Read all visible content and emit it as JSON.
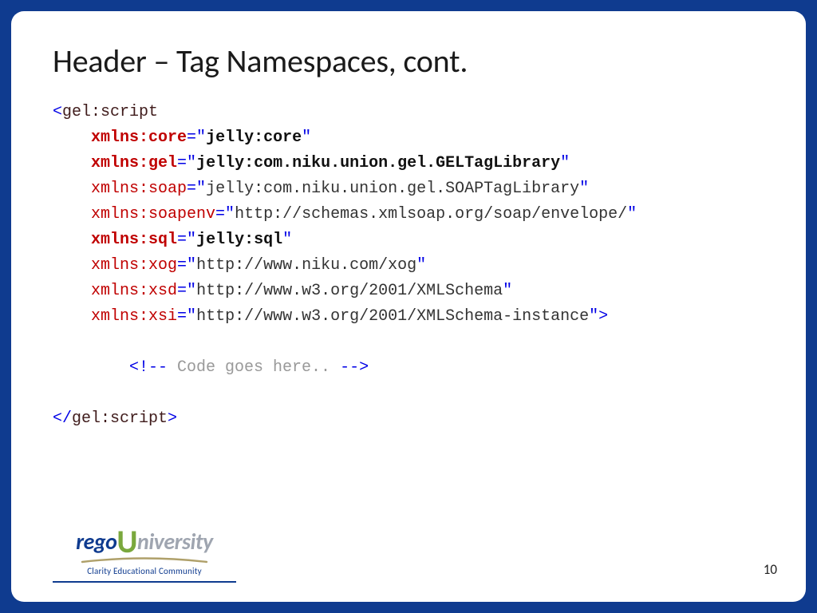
{
  "title": "Header – Tag Namespaces, cont.",
  "code": {
    "open_tag": "gel:script",
    "attrs": [
      {
        "name": "xmlns:core",
        "value": "jelly:core",
        "bold": true
      },
      {
        "name": "xmlns:gel",
        "value": "jelly:com.niku.union.gel.GELTagLibrary",
        "bold": true
      },
      {
        "name": "xmlns:soap",
        "value": "jelly:com.niku.union.gel.SOAPTagLibrary",
        "bold": false
      },
      {
        "name": "xmlns:soapenv",
        "value": "http://schemas.xmlsoap.org/soap/envelope/",
        "bold": false
      },
      {
        "name": "xmlns:sql",
        "value": "jelly:sql",
        "bold": true
      },
      {
        "name": "xmlns:xog",
        "value": "http://www.niku.com/xog",
        "bold": false
      },
      {
        "name": "xmlns:xsd",
        "value": "http://www.w3.org/2001/XMLSchema",
        "bold": false
      },
      {
        "name": "xmlns:xsi",
        "value": "http://www.w3.org/2001/XMLSchema-instance",
        "bold": false
      }
    ],
    "comment_open": "<!--",
    "comment_text": " Code goes here.. ",
    "comment_close": "-->",
    "close_tag": "gel:script"
  },
  "footer": {
    "logo_rego": "rego",
    "logo_u": "U",
    "logo_niv": "niversity",
    "tagline": "Clarity Educational Community",
    "page_number": "10"
  }
}
